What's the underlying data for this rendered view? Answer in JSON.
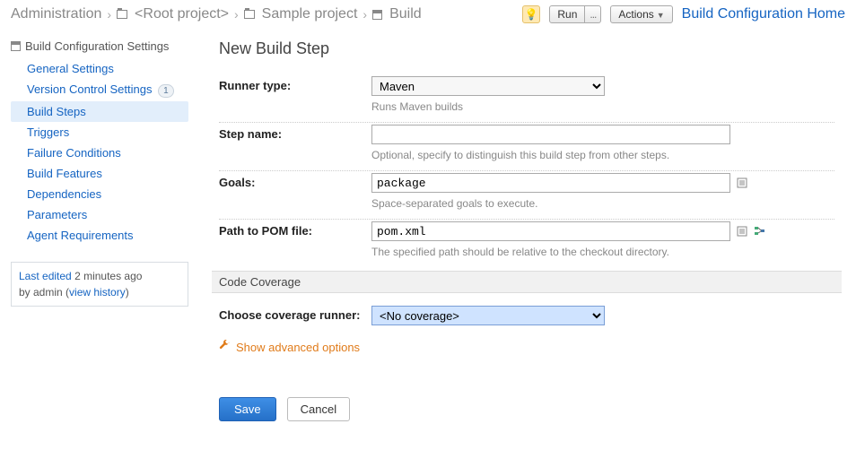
{
  "breadcrumb": {
    "admin": "Administration",
    "root": "<Root project>",
    "project": "Sample project",
    "config": "Build"
  },
  "header": {
    "run": "Run",
    "run_more": "...",
    "actions": "Actions",
    "home": "Build Configuration Home"
  },
  "sidebar": {
    "title": "Build Configuration Settings",
    "items": [
      {
        "label": "General Settings"
      },
      {
        "label": "Version Control Settings",
        "badge": "1"
      },
      {
        "label": "Build Steps",
        "active": true
      },
      {
        "label": "Triggers"
      },
      {
        "label": "Failure Conditions"
      },
      {
        "label": "Build Features"
      },
      {
        "label": "Dependencies"
      },
      {
        "label": "Parameters"
      },
      {
        "label": "Agent Requirements"
      }
    ],
    "meta_prefix": "Last edited",
    "meta_time": "2 minutes ago",
    "meta_by": "by admin  (",
    "meta_link": "view history",
    "meta_close": ")"
  },
  "form": {
    "title": "New Build Step",
    "runner_label": "Runner type:",
    "runner_value": "Maven",
    "runner_hint": "Runs Maven builds",
    "step_label": "Step name:",
    "step_value": "",
    "step_hint": "Optional, specify to distinguish this build step from other steps.",
    "goals_label": "Goals:",
    "goals_value": "package",
    "goals_hint": "Space-separated goals to execute.",
    "pom_label": "Path to POM file:",
    "pom_value": "pom.xml",
    "pom_hint": "The specified path should be relative to the checkout directory.",
    "coverage_header": "Code Coverage",
    "coverage_label": "Choose coverage runner:",
    "coverage_value": "<No coverage>",
    "advanced": "Show advanced options",
    "save": "Save",
    "cancel": "Cancel"
  }
}
